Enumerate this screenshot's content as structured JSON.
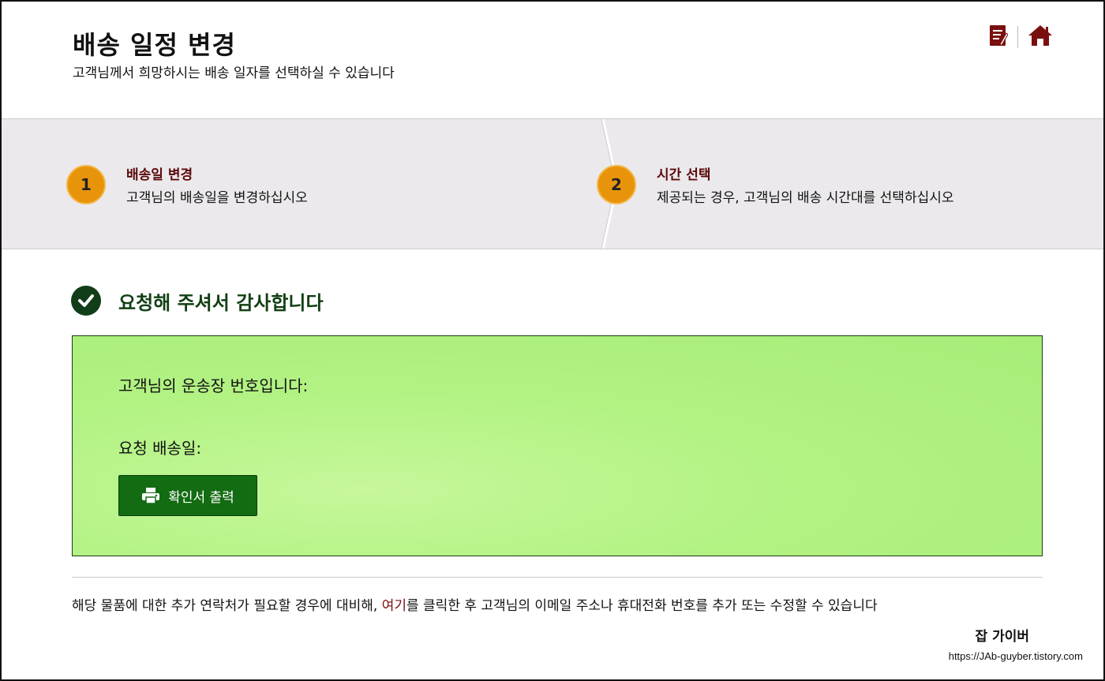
{
  "header": {
    "title": "배송 일정 변경",
    "subtitle": "고객님께서 희망하시는 배송 일자를 선택하실 수 있습니다",
    "icons": [
      "edit-document-icon",
      "home-icon"
    ]
  },
  "steps": [
    {
      "number": "1",
      "title": "배송일 변경",
      "description": "고객님의 배송일을 변경하십시오"
    },
    {
      "number": "2",
      "title": "시간 선택",
      "description": "제공되는 경우, 고객님의 배송 시간대를 선택하십시오"
    }
  ],
  "confirmation": {
    "heading": "요청해 주셔서 감사합니다",
    "tracking_label": "고객님의 운송장 번호입니다:",
    "date_label": "요청 배송일:",
    "print_button": "확인서 출력"
  },
  "footer": {
    "text_before": "해당 물품에 대한 추가 연락처가 필요할 경우에 대비해, ",
    "link": "여기",
    "text_after": "를 클릭한 후 고객님의 이메일 주소나 휴대전화 번호를 추가 또는 수정할 수 있습니다"
  },
  "watermark": {
    "name": "잡 가이버",
    "url": "https://JAb-guyber.tistory.com"
  },
  "colors": {
    "accent_red": "#7a0f0f",
    "step_circle": "#e8940a",
    "success_green": "#113d18",
    "box_green": "#b2f283",
    "button_green": "#136b12"
  }
}
